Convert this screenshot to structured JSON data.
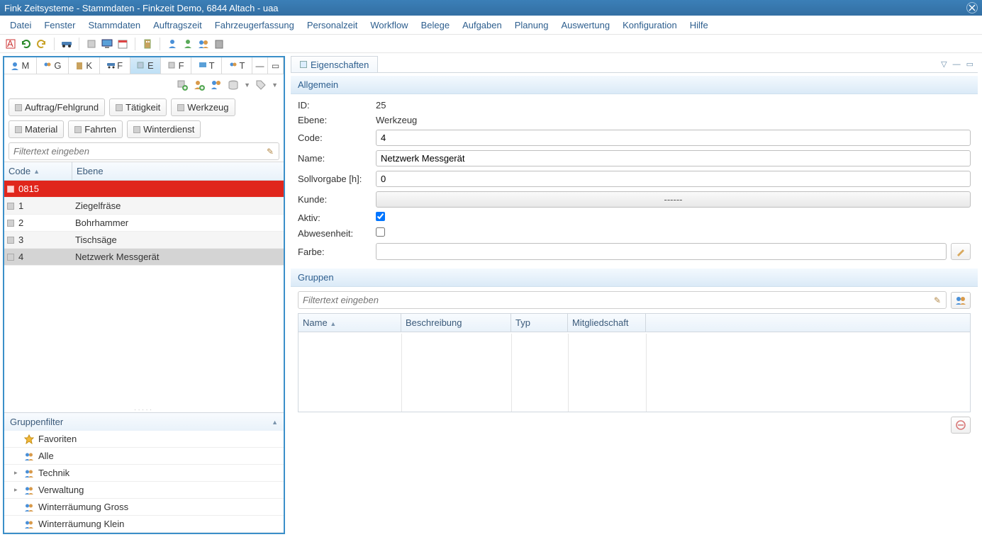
{
  "window": {
    "title": "Fink Zeitsysteme - Stammdaten - Finkzeit Demo, 6844 Altach - uaa"
  },
  "menu": [
    "Datei",
    "Fenster",
    "Stammdaten",
    "Auftragszeit",
    "Fahrzeugerfassung",
    "Personalzeit",
    "Workflow",
    "Belege",
    "Aufgaben",
    "Planung",
    "Auswertung",
    "Konfiguration",
    "Hilfe"
  ],
  "view_tabs": [
    {
      "letter": "M",
      "icon": "person"
    },
    {
      "letter": "G",
      "icon": "group"
    },
    {
      "letter": "K",
      "icon": "building"
    },
    {
      "letter": "F",
      "icon": "car"
    },
    {
      "letter": "E",
      "icon": "cube",
      "active": true
    },
    {
      "letter": "F",
      "icon": "cube"
    },
    {
      "letter": "T",
      "icon": "terminal"
    },
    {
      "letter": "T",
      "icon": "group"
    }
  ],
  "filter_buttons_row1": [
    "Auftrag/Fehlgrund",
    "Tätigkeit",
    "Werkzeug"
  ],
  "filter_buttons_row2": [
    "Material",
    "Fahrten",
    "Winterdienst"
  ],
  "left_filter_placeholder": "Filtertext eingeben",
  "grid": {
    "columns": {
      "code": "Code",
      "ebene": "Ebene"
    },
    "rows": [
      {
        "code": "0815",
        "ebene": "",
        "inactive": true
      },
      {
        "code": "1",
        "ebene": "Ziegelfräse"
      },
      {
        "code": "2",
        "ebene": "Bohrhammer"
      },
      {
        "code": "3",
        "ebene": "Tischsäge"
      },
      {
        "code": "4",
        "ebene": "Netzwerk Messgerät",
        "selected": true
      }
    ]
  },
  "group_filter": {
    "title": "Gruppenfilter",
    "items": [
      {
        "label": "Favoriten",
        "icon": "star"
      },
      {
        "label": "Alle",
        "icon": "group"
      },
      {
        "label": "Technik",
        "icon": "group",
        "expandable": true
      },
      {
        "label": "Verwaltung",
        "icon": "group",
        "expandable": true
      },
      {
        "label": "Winterräumung Gross",
        "icon": "group"
      },
      {
        "label": "Winterräumung Klein",
        "icon": "group"
      }
    ]
  },
  "properties_tab": "Eigenschaften",
  "section_allgemein": "Allgemein",
  "section_gruppen": "Gruppen",
  "form": {
    "labels": {
      "id": "ID:",
      "ebene": "Ebene:",
      "code": "Code:",
      "name": "Name:",
      "soll": "Sollvorgabe [h]:",
      "kunde": "Kunde:",
      "aktiv": "Aktiv:",
      "abw": "Abwesenheit:",
      "farbe": "Farbe:"
    },
    "values": {
      "id": "25",
      "ebene": "Werkzeug",
      "code": "4",
      "name": "Netzwerk Messgerät",
      "soll": "0",
      "kunde": "------",
      "aktiv": true,
      "abw": false,
      "farbe": ""
    }
  },
  "groups_filter_placeholder": "Filtertext eingeben",
  "groups_columns": [
    "Name",
    "Beschreibung",
    "Typ",
    "Mitgliedschaft"
  ]
}
